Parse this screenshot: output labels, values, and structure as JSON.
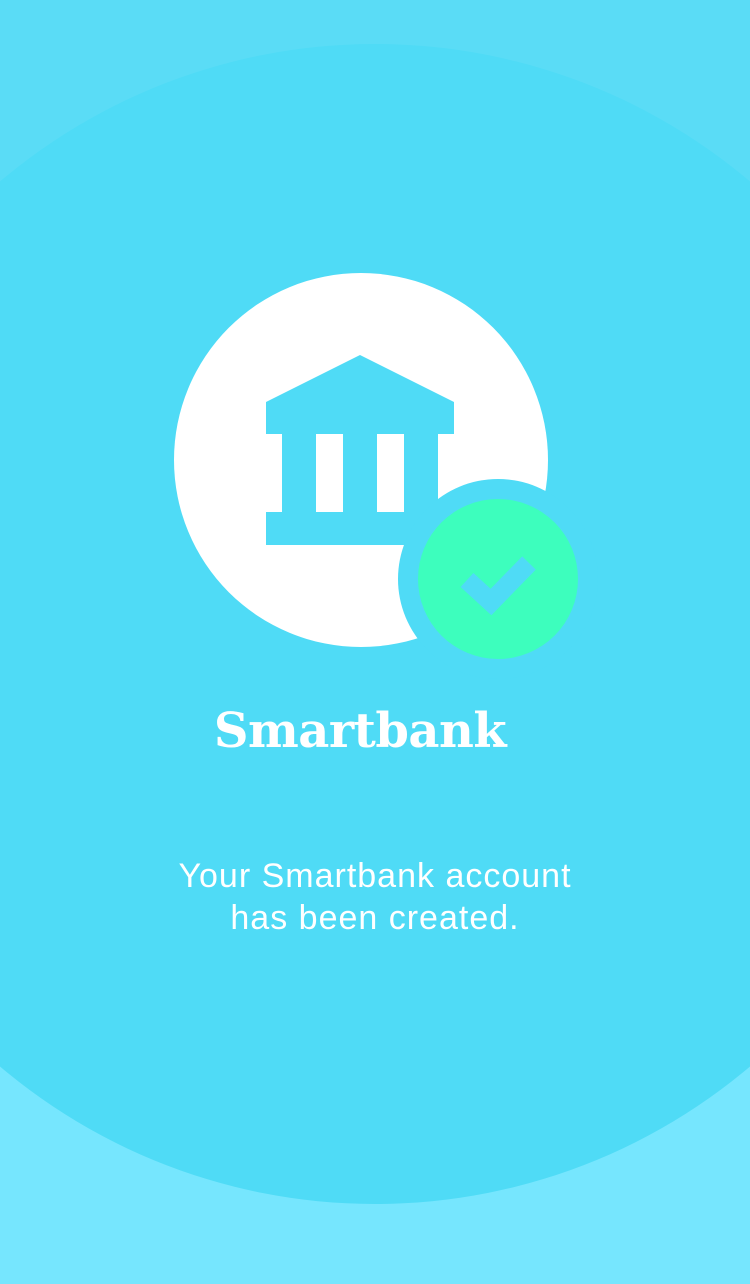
{
  "app": {
    "brand_name": "Smartbank"
  },
  "confirmation": {
    "message_line_1": "Your Smartbank account",
    "message_line_2": "has been created."
  },
  "icons": {
    "logo": "bank-building-icon",
    "status": "checkmark-badge-icon"
  },
  "colors": {
    "background": "#5adcf6",
    "background_disc": "#4fdbf6",
    "background_bottom": "#76e6fe",
    "logo_circle": "#ffffff",
    "success_badge": "#3dfebd",
    "text": "#ffffff"
  }
}
